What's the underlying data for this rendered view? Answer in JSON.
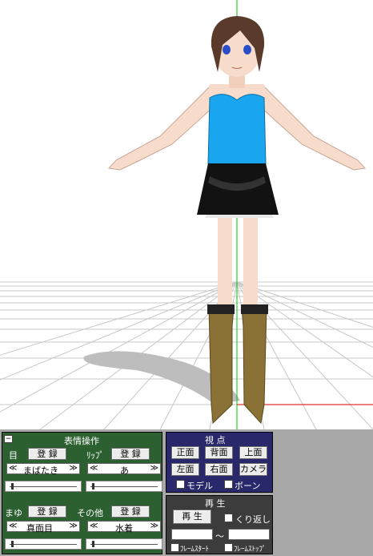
{
  "viewport": {
    "colors": {
      "grid": "#c8c8c8",
      "axis_y": "#00c800",
      "axis_x": "#e00000",
      "background": "#ffffff"
    }
  },
  "expression_panel": {
    "title": "表情操作",
    "collapse_icon": "minus-icon",
    "eye_label": "目",
    "lip_label": "ﾘｯﾌﾟ",
    "brow_label": "まゆ",
    "other_label": "その他",
    "register_label": "登 録",
    "prev_label": "≪",
    "next_label": "≫",
    "eye_value": "まばたき",
    "lip_value": "あ",
    "brow_value": "真面目",
    "other_value": "水着",
    "color": "#2d6030"
  },
  "view_panel": {
    "title": "視 点",
    "front_label": "正面",
    "back_label": "背面",
    "top_label": "上面",
    "left_label": "左面",
    "right_label": "右面",
    "camera_label": "カメラ",
    "model_label": "モデル",
    "bone_label": "ボーン",
    "color": "#28286a"
  },
  "play_panel": {
    "title": "再 生",
    "play_label": "再 生",
    "repeat_label": "くり返し",
    "range_separator": "～",
    "frame_start_label": "ﾌﾚｰﾑｽﾀｰﾄ",
    "frame_stop_label": "ﾌﾚｰﾑｽﾄｯﾌﾟ",
    "color": "#3c3c3c"
  }
}
